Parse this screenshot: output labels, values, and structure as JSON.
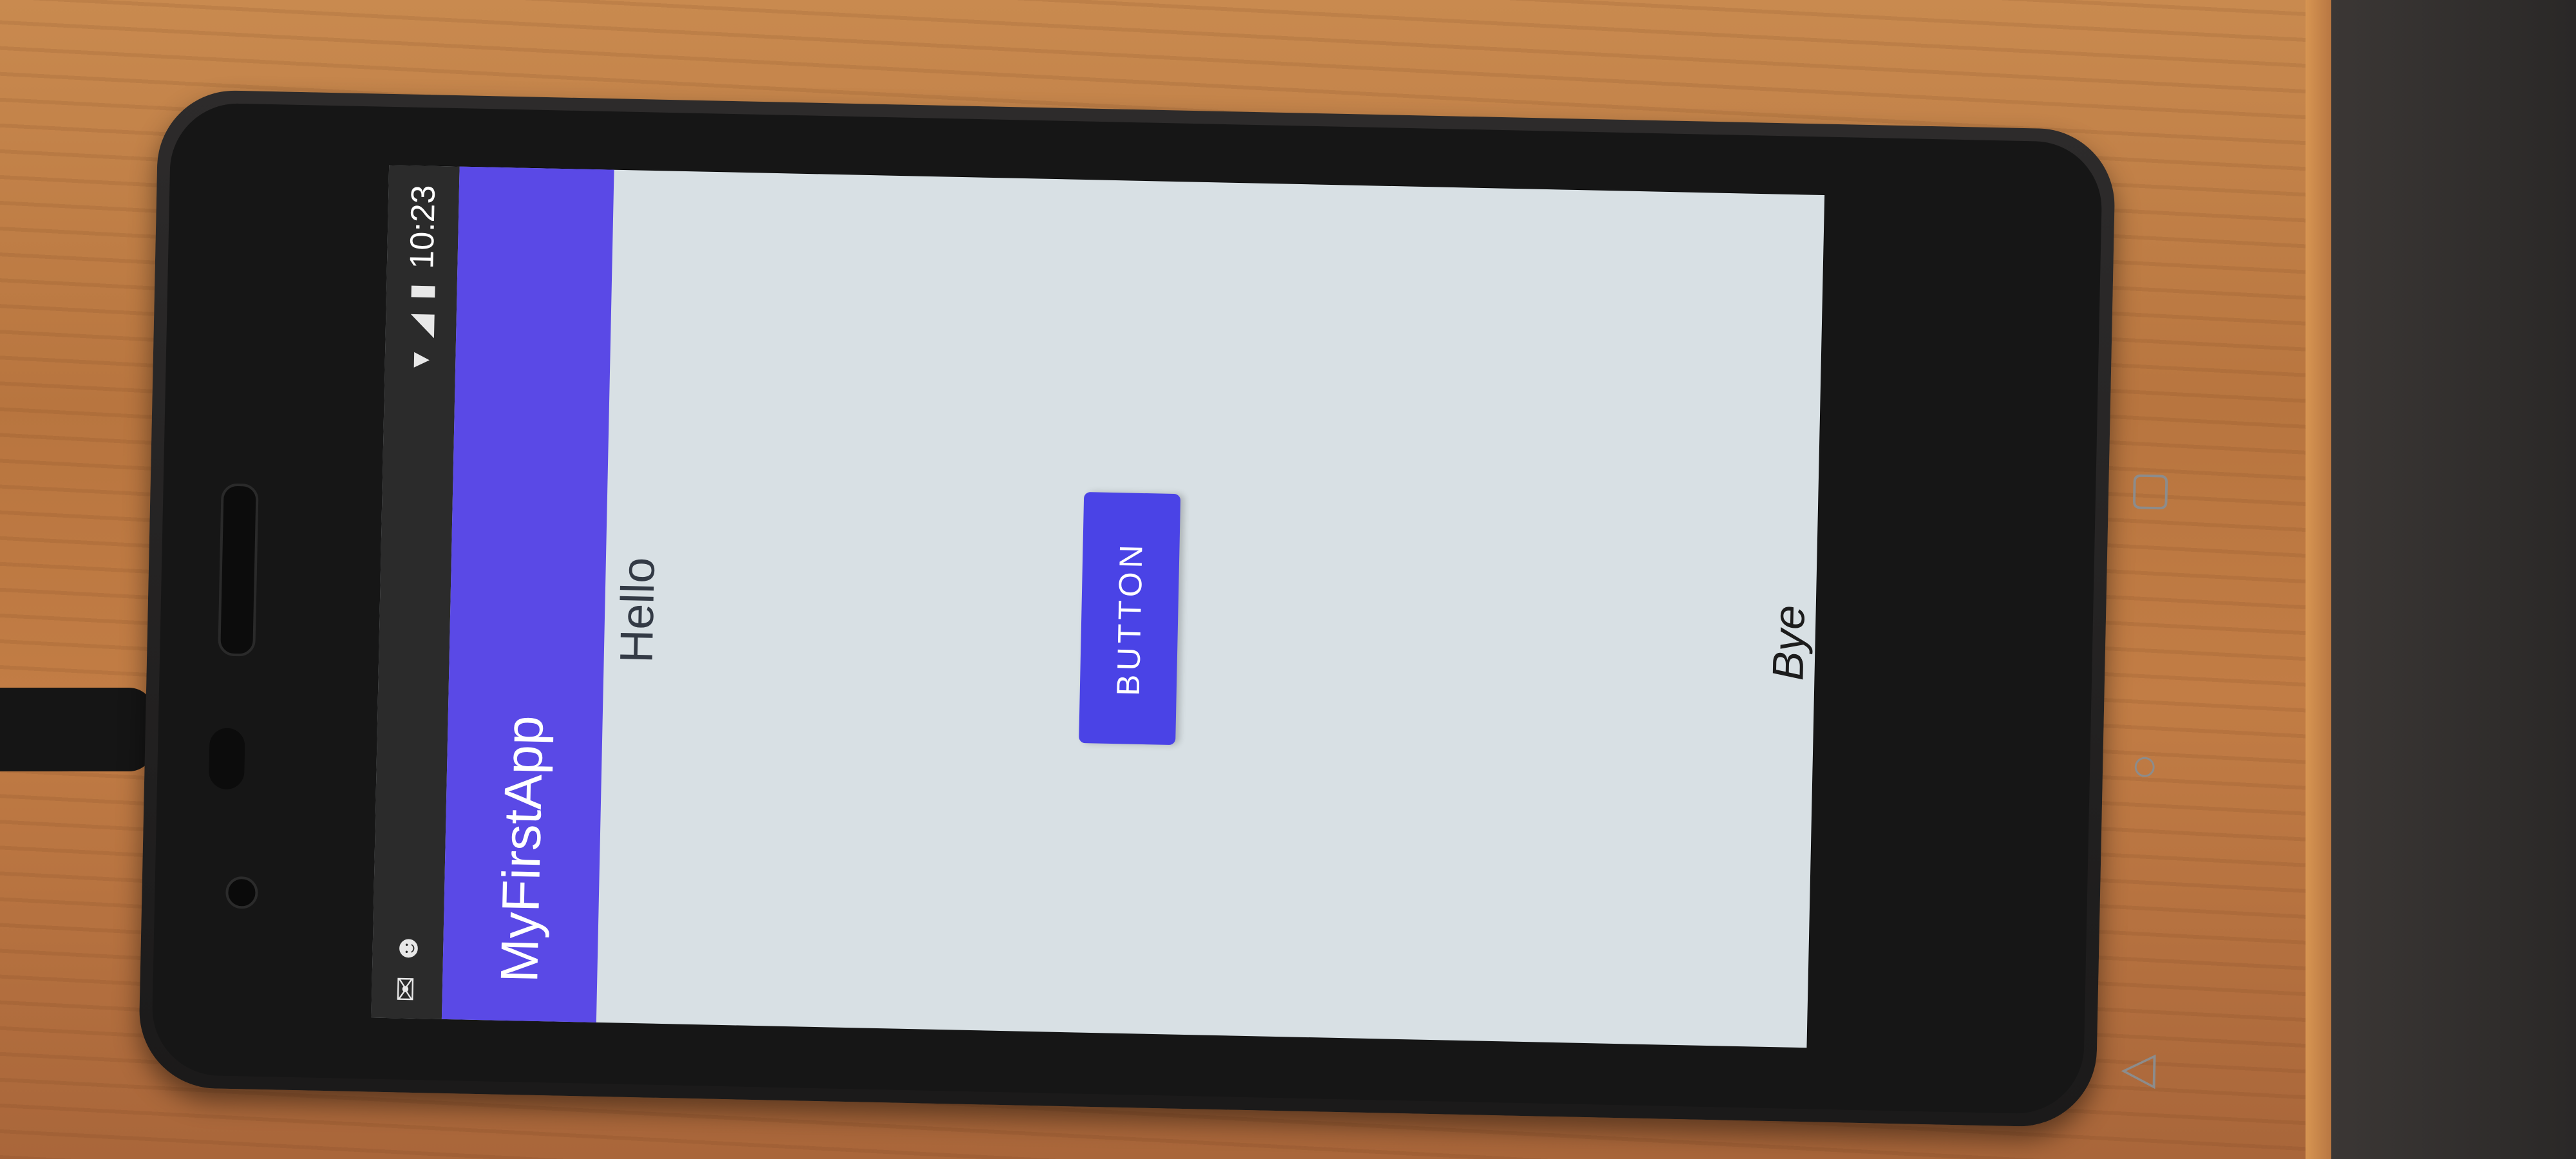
{
  "statusbar": {
    "time": "10:23",
    "left_icons": [
      "gmail-icon",
      "android-icon"
    ],
    "right_icons": [
      "wifi-icon",
      "signal-icon",
      "battery-icon"
    ]
  },
  "app": {
    "title": "MyFirstApp",
    "greeting": "Hello",
    "button_label": "BUTTON",
    "farewell": "Bye"
  },
  "navbar": {
    "icons": [
      "recent-apps-icon",
      "home-icon",
      "back-icon"
    ]
  },
  "colors": {
    "toolbar": "#5a49e6",
    "button": "#4a43e6",
    "background": "#d8e0e4"
  }
}
